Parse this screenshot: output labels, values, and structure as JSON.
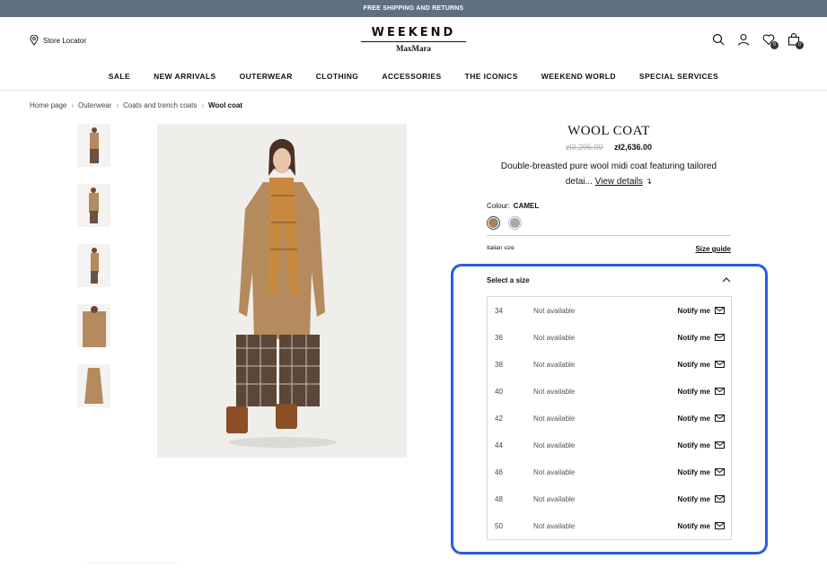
{
  "topbar": {
    "text": "FREE SHIPPING AND RETURNS"
  },
  "header": {
    "store_locator": "Store Locator",
    "logo_top": "WEEKEND",
    "logo_bottom": "MaxMara",
    "wishlist_count": "0",
    "bag_count": "0"
  },
  "nav": {
    "items": [
      "SALE",
      "NEW ARRIVALS",
      "OUTERWEAR",
      "CLOTHING",
      "ACCESSORIES",
      "THE ICONICS",
      "WEEKEND WORLD",
      "SPECIAL SERVICES"
    ]
  },
  "breadcrumb": {
    "items": [
      "Home page",
      "Outerwear",
      "Coats and trench coats",
      "Wool coat"
    ]
  },
  "product": {
    "title": "WOOL COAT",
    "old_price": "zł3,295.00",
    "new_price": "zł2,636.00",
    "desc_line1": "Double-breasted pure wool midi coat featuring tailored",
    "desc_line2": "detai...",
    "view_details": "View details",
    "colour_label": "Colour:",
    "colour_value": "CAMEL",
    "swatch_colors": [
      "#a9825a",
      "#a8a8a8"
    ],
    "size_system": "Italian size",
    "size_guide": "Size guide",
    "select_size": "Select a size"
  },
  "sizes": [
    {
      "size": "34",
      "status": "Not available",
      "action": "Notify me"
    },
    {
      "size": "36",
      "status": "Not available",
      "action": "Notify me"
    },
    {
      "size": "38",
      "status": "Not available",
      "action": "Notify me"
    },
    {
      "size": "40",
      "status": "Not available",
      "action": "Notify me"
    },
    {
      "size": "42",
      "status": "Not available",
      "action": "Notify me"
    },
    {
      "size": "44",
      "status": "Not available",
      "action": "Notify me"
    },
    {
      "size": "46",
      "status": "Not available",
      "action": "Notify me"
    },
    {
      "size": "48",
      "status": "Not available",
      "action": "Notify me"
    },
    {
      "size": "50",
      "status": "Not available",
      "action": "Notify me"
    }
  ],
  "colors": {
    "highlight": "#2c5be0",
    "topbar": "#5e6f80"
  }
}
